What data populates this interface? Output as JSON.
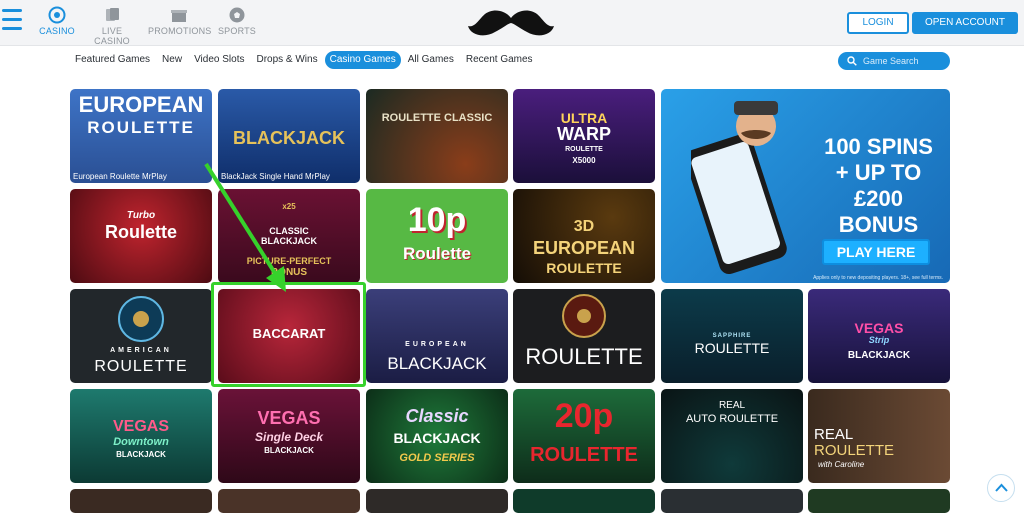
{
  "topnav": {
    "items": [
      {
        "label": "CASINO",
        "icon": "casino-chip-icon",
        "active": true
      },
      {
        "label": "LIVE CASINO",
        "icon": "playing-cards-icon",
        "active": false
      },
      {
        "label": "PROMOTIONS",
        "icon": "gift-icon",
        "active": false
      },
      {
        "label": "SPORTS",
        "icon": "soccer-ball-icon",
        "active": false
      }
    ],
    "logo": "mustache-logo",
    "login_label": "LOGIN",
    "open_account_label": "OPEN ACCOUNT"
  },
  "filters": {
    "items": [
      "Featured Games",
      "New",
      "Video Slots",
      "Drops & Wins",
      "Casino Games",
      "All Games",
      "Recent Games"
    ],
    "active": "Casino Games",
    "search_placeholder": "Game Search"
  },
  "games": [
    {
      "title_lines": [
        "EUROPEAN",
        "ROULETTE"
      ],
      "caption": "European Roulette MrPlay"
    },
    {
      "title_lines": [
        "BLACKJACK"
      ],
      "caption": "BlackJack Single Hand MrPlay"
    },
    {
      "title_lines": [
        "ROULETTE CLASSIC"
      ],
      "caption": ""
    },
    {
      "title_lines": [
        "ULTRA",
        "WARP",
        "ROULETTE",
        "X5000"
      ],
      "caption": ""
    },
    {
      "title_lines": [
        "Turbo",
        "Roulette"
      ],
      "caption": ""
    },
    {
      "title_lines": [
        "x25",
        "CLASSIC",
        "BLACKJACK",
        "PICTURE-PERFECT",
        "BONUS"
      ],
      "caption": ""
    },
    {
      "title_lines": [
        "10p",
        "Roulette"
      ],
      "caption": ""
    },
    {
      "title_lines": [
        "3D",
        "EUROPEAN",
        "ROULETTE"
      ],
      "caption": ""
    },
    {
      "title_lines": [
        "AMERICAN",
        "ROULETTE"
      ],
      "caption": ""
    },
    {
      "title_lines": [
        "BACCARAT"
      ],
      "caption": ""
    },
    {
      "title_lines": [
        "EUROPEAN",
        "BLACKJACK"
      ],
      "caption": ""
    },
    {
      "title_lines": [
        "ROULETTE"
      ],
      "caption": ""
    },
    {
      "title_lines": [
        "SAPPHIRE",
        "ROULETTE"
      ],
      "caption": ""
    },
    {
      "title_lines": [
        "VEGAS",
        "Strip",
        "BLACKJACK"
      ],
      "caption": ""
    },
    {
      "title_lines": [
        "VEGAS",
        "Downtown",
        "BLACKJACK"
      ],
      "caption": ""
    },
    {
      "title_lines": [
        "VEGAS",
        "Single Deck",
        "BLACKJACK"
      ],
      "caption": ""
    },
    {
      "title_lines": [
        "Classic",
        "BLACKJACK",
        "GOLD SERIES"
      ],
      "caption": ""
    },
    {
      "title_lines": [
        "20p",
        "ROULETTE"
      ],
      "caption": ""
    },
    {
      "title_lines": [
        "REAL",
        "AUTO ROULETTE"
      ],
      "caption": ""
    },
    {
      "title_lines": [
        "REAL",
        "ROULETTE",
        "with Caroline"
      ],
      "caption": ""
    }
  ],
  "promo": {
    "line1": "100 SPINS",
    "line2": "+ UP TO £200",
    "line3": "BONUS",
    "cta": "PLAY HERE",
    "fine_print": "Applies only to new depositing players. 18+, see full terms."
  },
  "colors": {
    "brand_blue": "#1a8fdc",
    "highlight_green": "#36d12b"
  }
}
